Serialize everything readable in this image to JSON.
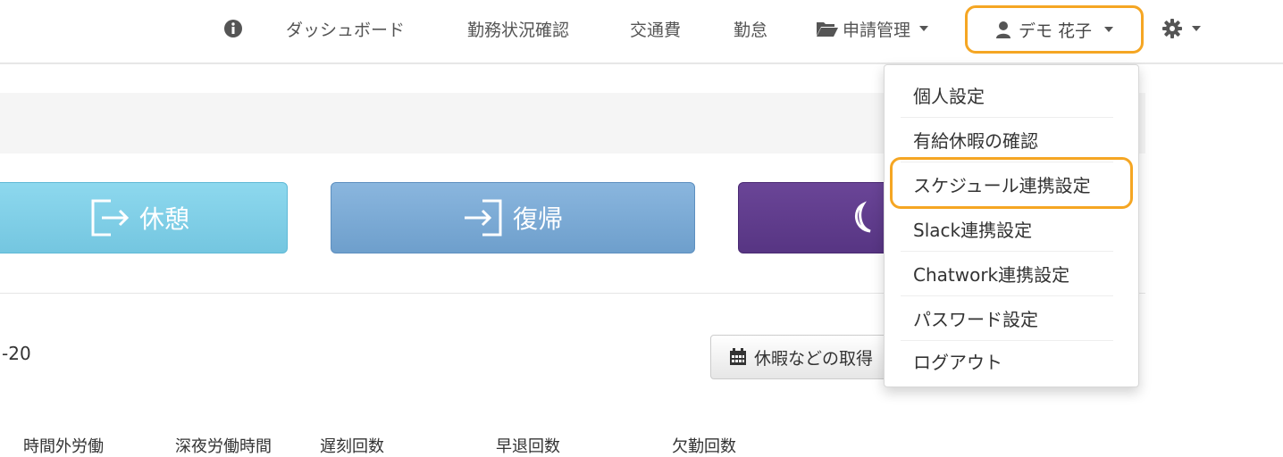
{
  "nav": {
    "dashboard": "ダッシュボード",
    "work_status": "勤務状況確認",
    "transport": "交通費",
    "attendance": "勤怠",
    "requests": "申請管理",
    "user_name": "デモ 花子"
  },
  "buttons": {
    "break": "休憩",
    "return": "復帰",
    "leave": "休暇などの取得"
  },
  "date_fragment": "-20",
  "stats": {
    "overtime": "時間外労働",
    "night_work": "深夜労働時間",
    "late_count": "遅刻回数",
    "early_leave_count": "早退回数",
    "absence_count": "欠勤回数"
  },
  "user_dropdown": {
    "items": [
      "個人設定",
      "有給休暇の確認",
      "スケジュール連携設定",
      "Slack連携設定",
      "Chatwork連携設定",
      "パスワード設定",
      "ログアウト"
    ]
  },
  "colors": {
    "highlight": "#f5a623",
    "break_button": "#7fcfe8",
    "return_button": "#7ca9d6",
    "end_button": "#5f3d8c"
  }
}
